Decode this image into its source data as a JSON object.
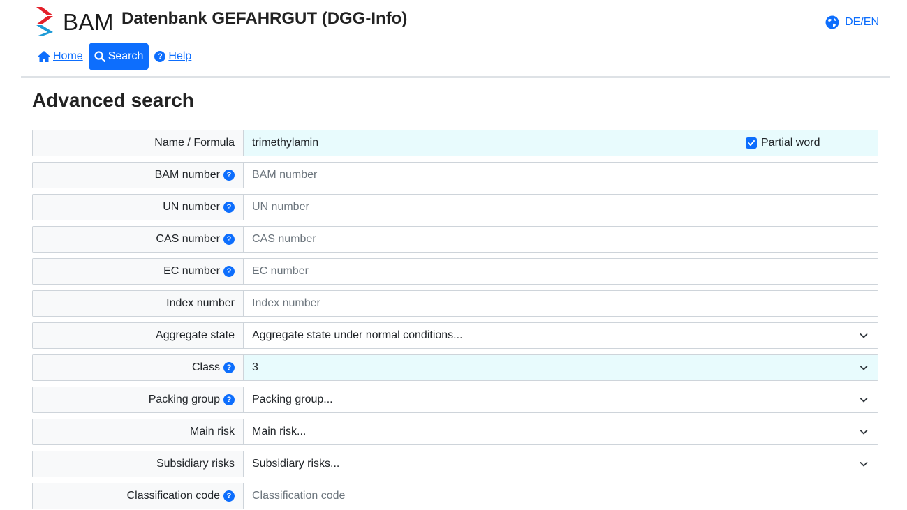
{
  "header": {
    "logo_text": "BAM",
    "app_title": "Datenbank GEFAHRGUT (DGG-Info)",
    "language_toggle": "DE/EN"
  },
  "nav": {
    "home": "Home",
    "search": "Search",
    "help": "Help"
  },
  "page_title": "Advanced search",
  "form": {
    "name_formula": {
      "label": "Name / Formula",
      "value": "trimethylamin",
      "partial_word_label": "Partial word",
      "partial_word_checked": true
    },
    "bam_number": {
      "label": "BAM number",
      "placeholder": "BAM number"
    },
    "un_number": {
      "label": "UN number",
      "placeholder": "UN number"
    },
    "cas_number": {
      "label": "CAS number",
      "placeholder": "CAS number"
    },
    "ec_number": {
      "label": "EC number",
      "placeholder": "EC number"
    },
    "index_number": {
      "label": "Index number",
      "placeholder": "Index number"
    },
    "aggregate_state": {
      "label": "Aggregate state",
      "value": "Aggregate state under normal conditions..."
    },
    "class": {
      "label": "Class",
      "value": "3"
    },
    "packing_group": {
      "label": "Packing group",
      "value": "Packing group..."
    },
    "main_risk": {
      "label": "Main risk",
      "value": "Main risk..."
    },
    "subsidiary_risks": {
      "label": "Subsidiary risks",
      "value": "Subsidiary risks..."
    },
    "classification_code": {
      "label": "Classification code",
      "placeholder": "Classification code"
    }
  },
  "colors": {
    "accent": "#0d6efd",
    "highlight": "#e8fbfd",
    "logo_red": "#e4202a",
    "logo_blue": "#1d9ad6"
  }
}
